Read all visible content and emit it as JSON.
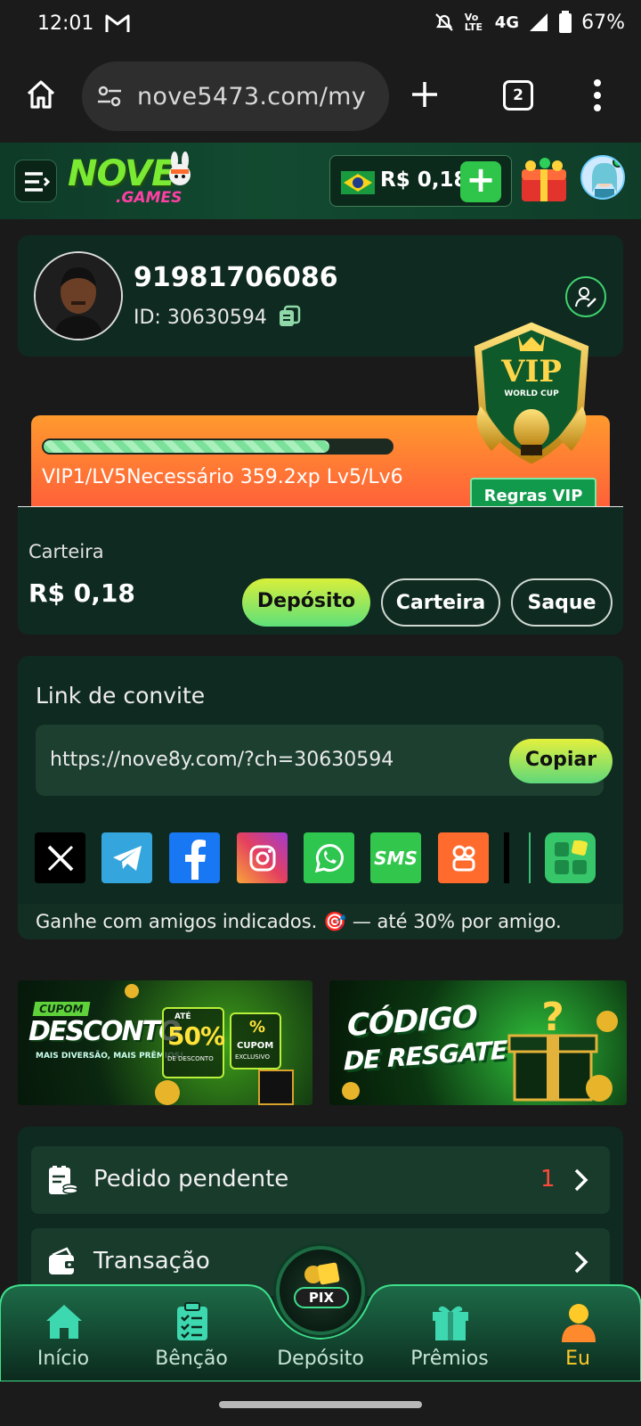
{
  "status_bar": {
    "time": "12:01",
    "network": "4G",
    "volte": "Vo LTE",
    "battery": "67%"
  },
  "browser": {
    "url": "nove5473.com/my",
    "tab_count": "2"
  },
  "header": {
    "logo_top": "NOVE",
    "logo_bottom": ".GAMES",
    "balance": "R$ 0,18",
    "accent": "#2fc54a"
  },
  "profile": {
    "username": "91981706086",
    "user_id": "ID: 30630594"
  },
  "vip": {
    "progress_text": "VIP1/LV5Necessário 359.2xp Lv5/Lv6",
    "progress_fraction": 0.82,
    "rules_label": "Regras VIP",
    "badge_top": "VIP",
    "badge_sub": "WORLD CUP"
  },
  "wallet": {
    "title": "Carteira",
    "amount": "R$ 0,18",
    "deposit_label": "Depósito",
    "wallet_label": "Carteira",
    "withdraw_label": "Saque"
  },
  "invite": {
    "title": "Link de convite",
    "link": "https://nove8y.com/?ch=30630594",
    "copy_label": "Copiar",
    "note": "Ganhe com amigos indicados. 🎯 — até 30% por amigo.",
    "socials": [
      {
        "name": "x",
        "color": "#000000"
      },
      {
        "name": "telegram",
        "color": "#35a6dd"
      },
      {
        "name": "facebook",
        "color": "#1877f2"
      },
      {
        "name": "instagram",
        "color": "#e4405f"
      },
      {
        "name": "whatsapp",
        "color": "#2fc650"
      },
      {
        "name": "sms",
        "color": "#32c74c"
      },
      {
        "name": "kwai",
        "color": "#ff6a2d"
      }
    ],
    "sms_label": "SMS"
  },
  "banners": {
    "b1_cupom": "CUPOM",
    "b1_desconto": "DESCONTO",
    "b1_sub": "MAIS DIVERSÃO, MAIS PRÊMIOS!",
    "b1_ate": "ATÉ",
    "b1_percent": "50%",
    "b1_dedesconto": "DE DESCONTO",
    "b1_cupom2": "CUPOM",
    "b1_exclusivo": "EXCLUSIVO",
    "b2_line1": "CÓDIGO",
    "b2_line2": "DE RESGATE"
  },
  "menu": {
    "items": [
      {
        "label": "Pedido pendente",
        "count": "1"
      },
      {
        "label": "Transação",
        "count": ""
      }
    ]
  },
  "bottom_nav": {
    "items": [
      {
        "label": "Início"
      },
      {
        "label": "Bênção"
      },
      {
        "label": "Depósito"
      },
      {
        "label": "Prêmios"
      },
      {
        "label": "Eu"
      }
    ],
    "pix_label": "PIX",
    "active_color": "#ffc928"
  }
}
